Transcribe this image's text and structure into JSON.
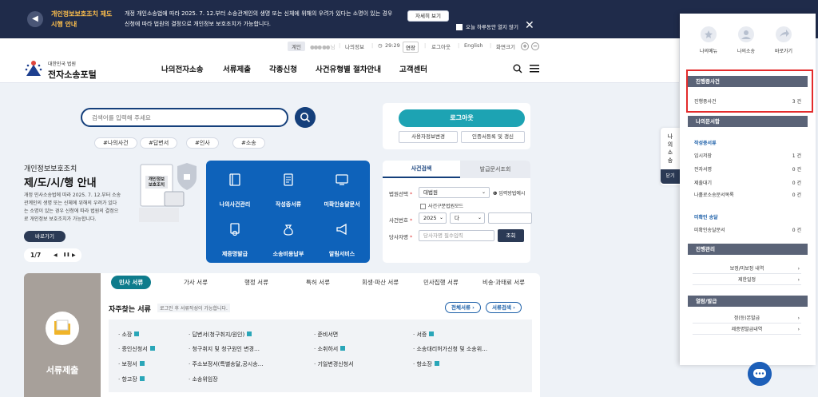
{
  "notice": {
    "title_line1": "개인정보보호조치 제도",
    "title_line2": "시행 안내",
    "message_line1": "개정 개인소송법에 따라 2025. 7. 12.부터 소송관계인의 생명 또는 신체에 위해의 우려가 있다는 소명이 있는 경우",
    "message_line2": "신청에 따라 법원의 결정으로 개인정보 보호조치가 가능합니다.",
    "detail_button": "자세히 보기",
    "hide_today": "오늘 하루동안 열지 않기"
  },
  "util": {
    "gov_badge": "계인",
    "blurred_name": "●●● ●● 님",
    "my_info": "나의정보",
    "timer": "29:29",
    "extend": "연장",
    "logout": "로그아웃",
    "english": "English",
    "zoom": "화면크기",
    "zoom_in": "+",
    "zoom_out": "−"
  },
  "nav": {
    "logo_sub": "대한민국 법원",
    "logo_main": "전자소송포털",
    "items": [
      "나의전자소송",
      "서류제출",
      "각종신청",
      "사건유형별 절차안내",
      "고객센터"
    ]
  },
  "search": {
    "placeholder": "검색어를 입력해 주세요",
    "tags": [
      "#나의사건",
      "#답변서",
      "#인사",
      "#소송"
    ]
  },
  "login": {
    "logout_button": "로그아웃",
    "user_info_change": "사용자정보변경",
    "cert_register": "인증서등록 및 갱신"
  },
  "promo": {
    "subtitle": "개인정보보호조치",
    "title": "제/도/시/행 안내",
    "desc_lines": [
      "개정 민사소송법에 따라 2025. 7. 12.부터 소송",
      "관계인의 생명 또는 신체에 위해의 우려가 있다",
      "는 소명이 있는 경우 신청에 따라 법원의 결정으",
      "로 개인정보 보호조치가 가능합니다."
    ],
    "shortcut": "바로가기",
    "page": "1/7",
    "prev": "◀",
    "pause": "❚❚",
    "next": "▶",
    "illustration_line1": "개인정보",
    "illustration_line2": "보호조치"
  },
  "services": [
    {
      "label": "나의사건관리",
      "icon": "book-icon"
    },
    {
      "label": "작성중서류",
      "icon": "document-icon"
    },
    {
      "label": "미확인송달문서",
      "icon": "monitor-icon"
    },
    {
      "label": "제증명발급",
      "icon": "certificate-icon"
    },
    {
      "label": "소송비용납부",
      "icon": "money-bag-icon"
    },
    {
      "label": "알림서비스",
      "icon": "megaphone-icon"
    }
  ],
  "case_search": {
    "tab_active": "사건검색",
    "tab_inactive": "발급문서조회",
    "court_label": "법원선택",
    "court_value": "대법원",
    "court_help": "입력방법예시",
    "court_checkbox": "사건구분법원모드",
    "case_no_label": "사건번호",
    "year": "2025",
    "case_type": "다",
    "party_label": "당사자명",
    "party_placeholder": "당사자명 필수입력",
    "search_button": "조회",
    "required_mark": "*"
  },
  "documents": {
    "tabs": [
      "민사 서류",
      "가사 서류",
      "행정 서류",
      "특허 서류",
      "회생·파산 서류",
      "민사집행 서류",
      "비송·과태료 서류"
    ],
    "side_label": "서류제출",
    "section_title": "자주찾는 서류",
    "section_note": "로그인 후 서류작성이 가능합니다.",
    "all_docs_button": "전체서류 ›",
    "doc_search_button": "서류검색 ›",
    "items": [
      "· 소장",
      "· 답변서(청구취지/원인)",
      "· 준비서면",
      "· 서증",
      "· 증인신청서",
      "· 청구취지 및 청구원인 변경…",
      "· 소취하서",
      "· 소송대리허가신청 및 소송위…",
      "· 보정서",
      "· 주소보정서(특별송달,공시송…",
      "· 기일변경신청서",
      "· 항소장",
      "· 항고장",
      "· 소송위임장"
    ]
  },
  "right_panel": {
    "top": [
      {
        "label": "나의메뉴",
        "icon": "star-icon"
      },
      {
        "label": "나의소송",
        "icon": "person-icon"
      },
      {
        "label": "바로가기",
        "icon": "arrow-icon"
      }
    ],
    "progress_header": "진행중사건",
    "progress_label": "진행중사건",
    "progress_count": "3 건",
    "mydocs_header": "나의문서함",
    "writing_title": "작성중서류",
    "writing_rows": [
      {
        "label": "임시저장",
        "count": "1 건"
      },
      {
        "label": "전자서명",
        "count": "0 건"
      },
      {
        "label": "제출대기",
        "count": "0 건"
      },
      {
        "label": "나홀로소송문서목록",
        "count": "0 건"
      }
    ],
    "unconfirmed_title": "미확인 송달",
    "unconfirmed_row": {
      "label": "미확인송달문서",
      "count": "0 건"
    },
    "progress_mgmt_header": "진행관리",
    "progress_links": [
      "보정/미보정 내역",
      "제한일정"
    ],
    "issue_header": "열람/발급",
    "issue_links": [
      "정(등)본발급",
      "제증명발급내역"
    ],
    "side_tab": [
      "나",
      "의",
      "소",
      "송"
    ],
    "side_close": "닫기"
  }
}
